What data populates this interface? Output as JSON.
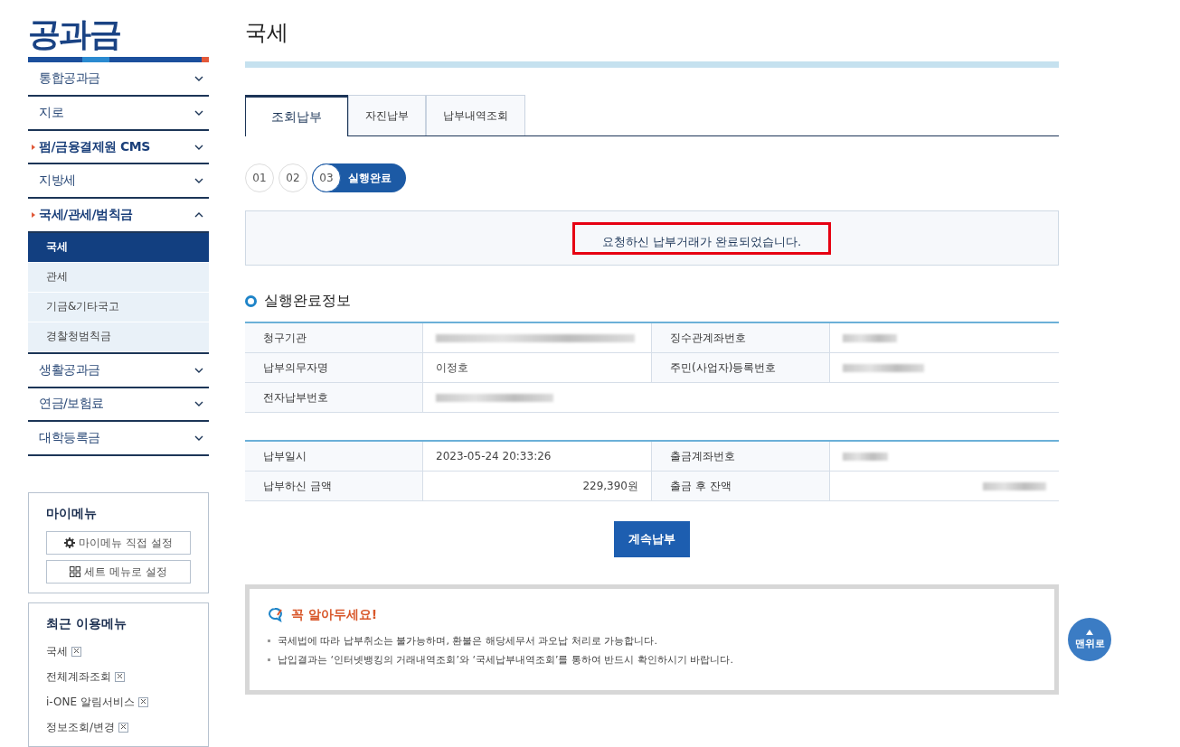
{
  "sidebar": {
    "title": "공과금",
    "menu": [
      {
        "label": "통합공과금",
        "marked": false,
        "expanded": false
      },
      {
        "label": "지로",
        "marked": false,
        "expanded": false
      },
      {
        "label": "펌/금융결제원 CMS",
        "marked": true,
        "expanded": false
      },
      {
        "label": "지방세",
        "marked": false,
        "expanded": false
      },
      {
        "label": "국세/관세/범칙금",
        "marked": true,
        "expanded": true,
        "children": [
          {
            "label": "국세",
            "selected": true
          },
          {
            "label": "관세",
            "selected": false
          },
          {
            "label": "기금&기타국고",
            "selected": false
          },
          {
            "label": "경찰청범칙금",
            "selected": false
          }
        ]
      },
      {
        "label": "생활공과금",
        "marked": false,
        "expanded": false
      },
      {
        "label": "연금/보험료",
        "marked": false,
        "expanded": false
      },
      {
        "label": "대학등록금",
        "marked": false,
        "expanded": false
      }
    ],
    "my_menu": {
      "title": "마이메뉴",
      "buttons": [
        {
          "kind": "gear",
          "label": "마이메뉴 직접 설정"
        },
        {
          "kind": "grid",
          "label": "세트 메뉴로 설정"
        }
      ]
    },
    "recent_menu": {
      "title": "최근 이용메뉴",
      "items": [
        "국세",
        "전체계좌조회",
        "i-ONE 알림서비스",
        "정보조회/변경"
      ]
    }
  },
  "page": {
    "title": "국세",
    "tabs": [
      {
        "label": "조회납부",
        "selected": true
      },
      {
        "label": "자진납부",
        "selected": false
      },
      {
        "label": "납부내역조회",
        "selected": false
      }
    ],
    "steps": [
      {
        "number": "01",
        "selected": false
      },
      {
        "number": "02",
        "selected": false
      },
      {
        "number": "03",
        "selected": true,
        "label": "실행완료"
      }
    ],
    "message": {
      "text": "요청하신 납부거래가 완료되었습니다.",
      "highlighted": true
    },
    "section_title": "실행완료정보",
    "tables": [
      {
        "rows": [
          [
            {
              "label": "청구기관",
              "redacted": true
            },
            {
              "label": "징수관계좌번호",
              "redacted": true
            }
          ],
          [
            {
              "label": "납부의무자명",
              "value": "이정호"
            },
            {
              "label": "주민(사업자)등록번호",
              "redacted": true
            }
          ],
          [
            {
              "label": "전자납부번호",
              "redacted": true
            }
          ]
        ]
      },
      {
        "rows": [
          [
            {
              "label": "납부일시",
              "value": "2023-05-24 20:33:26"
            },
            {
              "label": "출금계좌번호",
              "redacted": true
            }
          ],
          [
            {
              "label": "납부하신 금액",
              "value": "229,390원",
              "kind": "amount"
            },
            {
              "label": "출금 후 잔액",
              "redacted": true,
              "kind": "amount"
            }
          ]
        ]
      }
    ],
    "continue_button": "계속납부",
    "notice": {
      "title": "꼭 알아두세요!",
      "items": [
        "국세법에 따라 납부취소는 불가능하며, 환불은 해당세무서 과오납 처리로 가능합니다.",
        "납입결과는 ‘인터넷뱅킹의 거래내역조회’와 ‘국세납부내역조회’를 통하여 반드시 확인하시기 바랍니다."
      ]
    },
    "top_button": "맨위로"
  }
}
